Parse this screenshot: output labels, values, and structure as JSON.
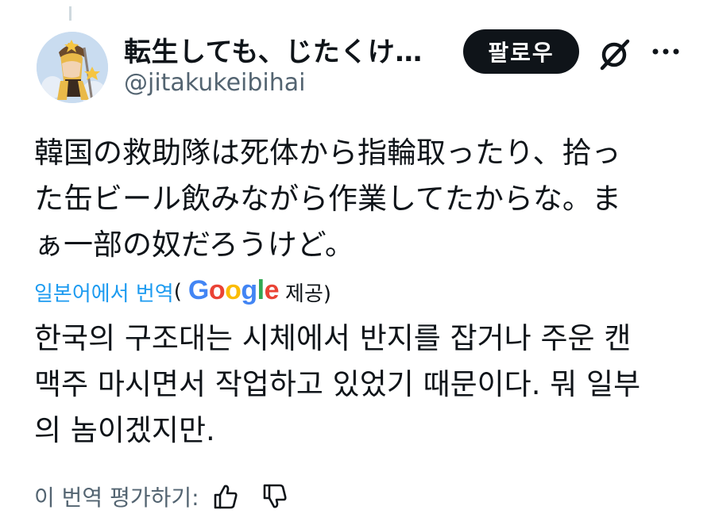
{
  "author": {
    "display_name": "転生しても、じたくけ…",
    "handle": "@jitakukeibihai"
  },
  "header": {
    "follow_label": "팔로우",
    "grok_icon": "grok-icon",
    "more_icon": "more-icon"
  },
  "tweet": {
    "lines": [
      "韓国の救助隊は死体から指輪取ったり、拾っ",
      "た缶ビール飲みながら作業してたからな。ま",
      "ぁ一部の奴だろうけど。"
    ]
  },
  "translation": {
    "link_label": "일본어에서 번역",
    "open_paren": "(",
    "provider": "Google",
    "provided_label": "제공)",
    "lines": [
      "한국의 구조대는 시체에서 반지를 잡거나 주운 캔",
      "맥주 마시면서 작업하고 있었기 때문이다. 뭐 일부",
      "의 놈이겠지만."
    ],
    "rate_label": "이 번역 평가하기:"
  },
  "colors": {
    "link": "#1d9bf0",
    "muted": "#536471",
    "text": "#0f1419"
  }
}
